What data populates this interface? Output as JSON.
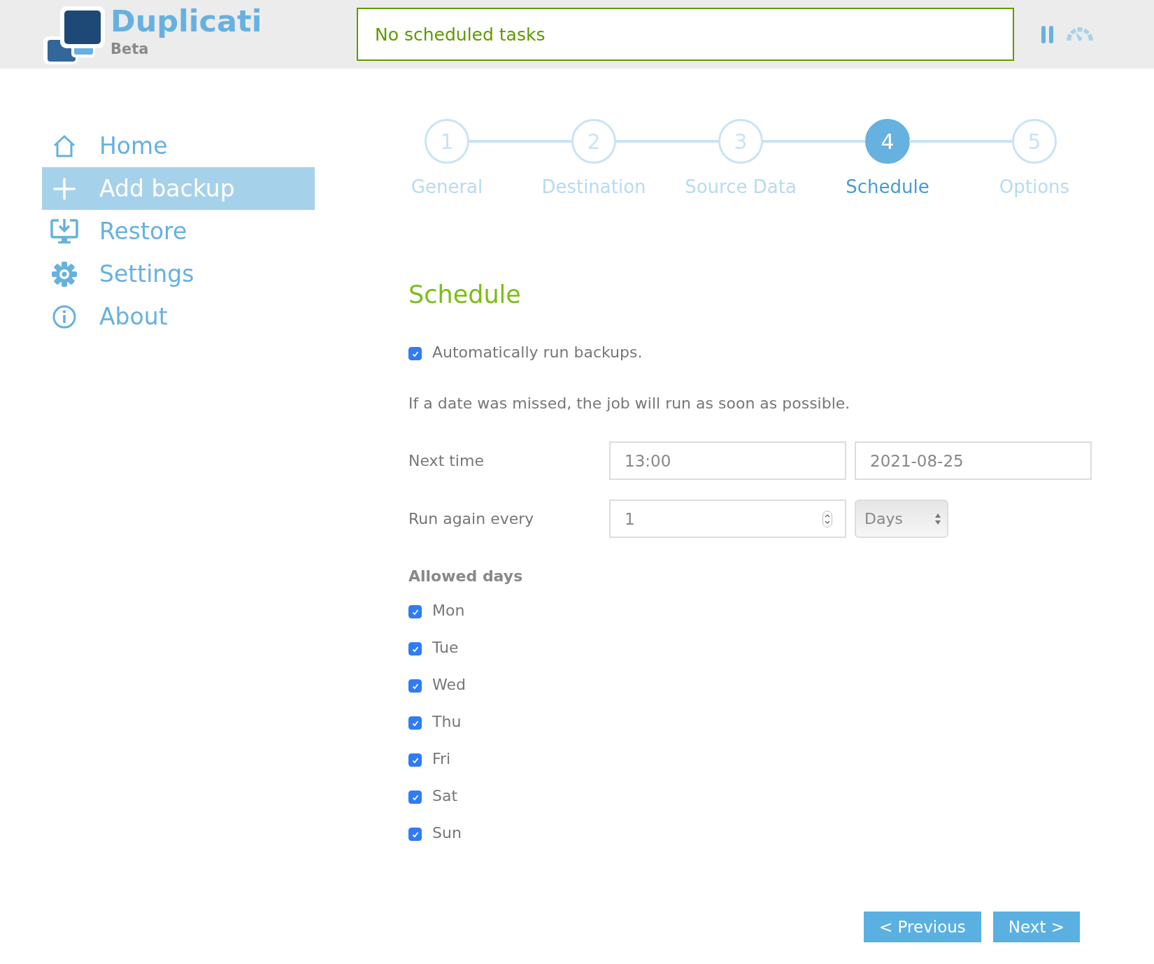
{
  "header": {
    "title": "Duplicati",
    "subtitle": "Beta",
    "status": "No scheduled tasks"
  },
  "sidebar": {
    "items": [
      {
        "label": "Home",
        "selected": false
      },
      {
        "label": "Add backup",
        "selected": true
      },
      {
        "label": "Restore",
        "selected": false
      },
      {
        "label": "Settings",
        "selected": false
      },
      {
        "label": "About",
        "selected": false
      }
    ]
  },
  "steps": [
    {
      "number": "1",
      "label": "General",
      "selected": false
    },
    {
      "number": "2",
      "label": "Destination",
      "selected": false
    },
    {
      "number": "3",
      "label": "Source Data",
      "selected": false
    },
    {
      "number": "4",
      "label": "Schedule",
      "selected": true
    },
    {
      "number": "5",
      "label": "Options",
      "selected": false
    }
  ],
  "schedule": {
    "heading": "Schedule",
    "auto_run": {
      "label": "Automatically run backups.",
      "checked": true
    },
    "note": "If a date was missed, the job will run as soon as possible.",
    "next_time": {
      "label": "Next time",
      "time": "13:00",
      "date": "2021-08-25"
    },
    "run_again": {
      "label": "Run again every",
      "value": "1",
      "unit": "Days"
    },
    "allowed_days": {
      "heading": "Allowed days",
      "days": [
        {
          "label": "Mon",
          "checked": true
        },
        {
          "label": "Tue",
          "checked": true
        },
        {
          "label": "Wed",
          "checked": true
        },
        {
          "label": "Thu",
          "checked": true
        },
        {
          "label": "Fri",
          "checked": true
        },
        {
          "label": "Sat",
          "checked": true
        },
        {
          "label": "Sun",
          "checked": true
        }
      ]
    }
  },
  "buttons": {
    "previous": "< Previous",
    "next": "Next >"
  }
}
